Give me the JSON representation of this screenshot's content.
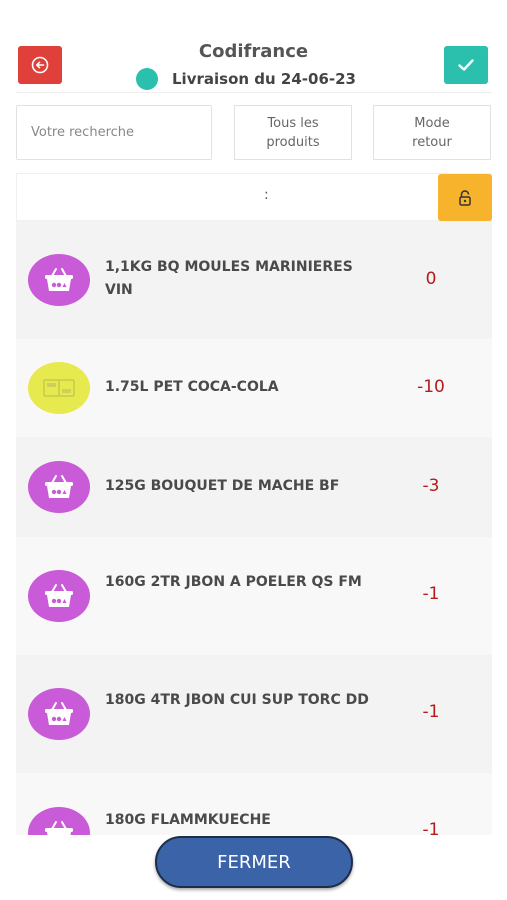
{
  "header": {
    "title": "Codifrance",
    "delivery": "Livraison du 24-06-23",
    "back_icon": "back-arrow-icon",
    "confirm_icon": "check-icon",
    "status_color": "#2bbfae"
  },
  "search": {
    "placeholder": "Votre recherche",
    "value": ""
  },
  "options": {
    "all_products": "Tous les\nproduits",
    "return_mode": "Mode\nretour"
  },
  "filter": {
    "text": ":",
    "lock_icon": "lock-icon"
  },
  "products": [
    {
      "name": "1,1KG BQ MOULES MARINIERES VIN",
      "qty": "0",
      "icon": "basket-icon"
    },
    {
      "name": "1.75L PET COCA-COLA",
      "qty": "-10",
      "icon": "product-image"
    },
    {
      "name": "125G BOUQUET DE MACHE BF",
      "qty": "-3",
      "icon": "basket-icon"
    },
    {
      "name": "160G 2TR JBON A POELER QS FM",
      "qty": "-1",
      "icon": "basket-icon"
    },
    {
      "name": "180G 4TR JBON CUI SUP TORC DD",
      "qty": "-1",
      "icon": "basket-icon"
    },
    {
      "name": "180G FLAMMKUECHE",
      "qty": "-1",
      "icon": "basket-icon"
    }
  ],
  "footer": {
    "close_label": "FERMER"
  },
  "colors": {
    "danger": "#e0403a",
    "accent": "#2bbfae",
    "warning": "#f7b32b",
    "qty": "#b41b1b",
    "button": "#3a63a8"
  }
}
